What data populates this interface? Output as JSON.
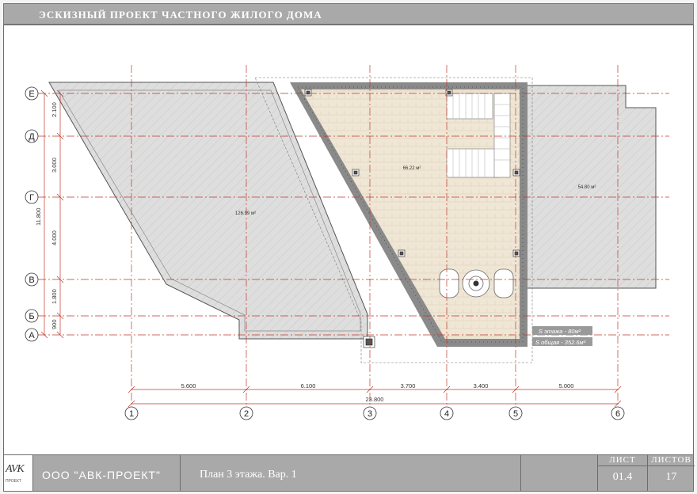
{
  "title": "ЭСКИЗНЫЙ ПРОЕКТ ЧАСТНОГО ЖИЛОГО ДОМА",
  "row_axes": [
    "Е",
    "Д",
    "Г",
    "В",
    "Б",
    "А"
  ],
  "column_axes": [
    "1",
    "2",
    "3",
    "4",
    "5",
    "6"
  ],
  "vertical_dimensions": [
    "2.100",
    "3.000",
    "4.000",
    "1.800",
    "900"
  ],
  "total_vertical_dimension": "11.800",
  "horizontal_dimensions": [
    "5.600",
    "6.100",
    "3.700",
    "3.400",
    "5.000"
  ],
  "total_horizontal_dimension": "23.800",
  "area_labels": {
    "terrace_left": "126.99 м²",
    "interior": "66.22 м²",
    "terrace_right": "54.80 м²"
  },
  "area_notes": {
    "floor_area": "S этажа - 80м²",
    "total_area": "S общая - 352.6м²"
  },
  "stamp": {
    "logo": "AVK",
    "logo_sub": "ПРОЕКТ",
    "company": "ООО \"АВК-ПРОЕКТ\"",
    "sheet_name": "План 3 этажа. Вар. 1",
    "sheet_label": "ЛИСТ",
    "sheet_number": "01.4",
    "sheets_label": "ЛИСТОВ",
    "sheets_total": "17"
  },
  "colors": {
    "axis": "#c0392b",
    "terrace_fill": "#dcdcdc",
    "interior_fill": "#efe7d7",
    "wall": "#8a8a8a",
    "title_bar": "#a9a9a9"
  }
}
